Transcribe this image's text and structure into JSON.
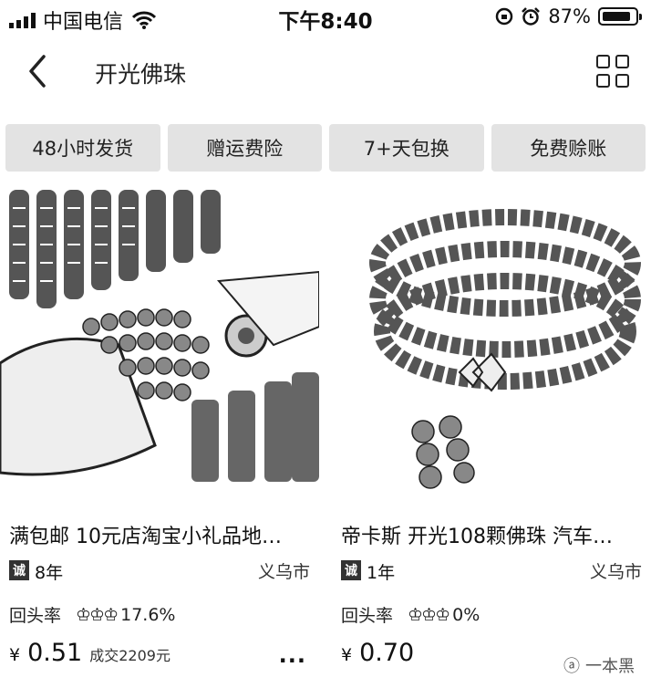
{
  "status_bar": {
    "carrier": "中国电信",
    "time": "下午8:40",
    "battery_text": "87%",
    "battery_level": 0.87,
    "icons": [
      "signal-icon",
      "wifi-icon",
      "lock-rotation-icon",
      "alarm-icon",
      "battery-icon"
    ]
  },
  "nav": {
    "title": "开光佛珠",
    "back_icon": "chevron-left-icon",
    "view_toggle_icon": "grid-view-icon"
  },
  "filters": [
    "48小时发货",
    "赠运费险",
    "7+天包换",
    "免费赊账"
  ],
  "products": [
    {
      "title": "满包邮 10元店淘宝小礼品地…",
      "badge": "诚",
      "years": "8年",
      "city": "义乌市",
      "rate_label": "回头率",
      "rate_value": "17.6%",
      "currency": "¥",
      "price": "0.51",
      "sold": "成交2209元",
      "more": "..."
    },
    {
      "title": "帝卡斯 开光108颗佛珠 汽车…",
      "badge": "诚",
      "years": "1年",
      "city": "义乌市",
      "rate_label": "回头率",
      "rate_value": "0%",
      "currency": "¥",
      "price": "0.70",
      "sold": "",
      "watermark": "一本黑"
    }
  ]
}
